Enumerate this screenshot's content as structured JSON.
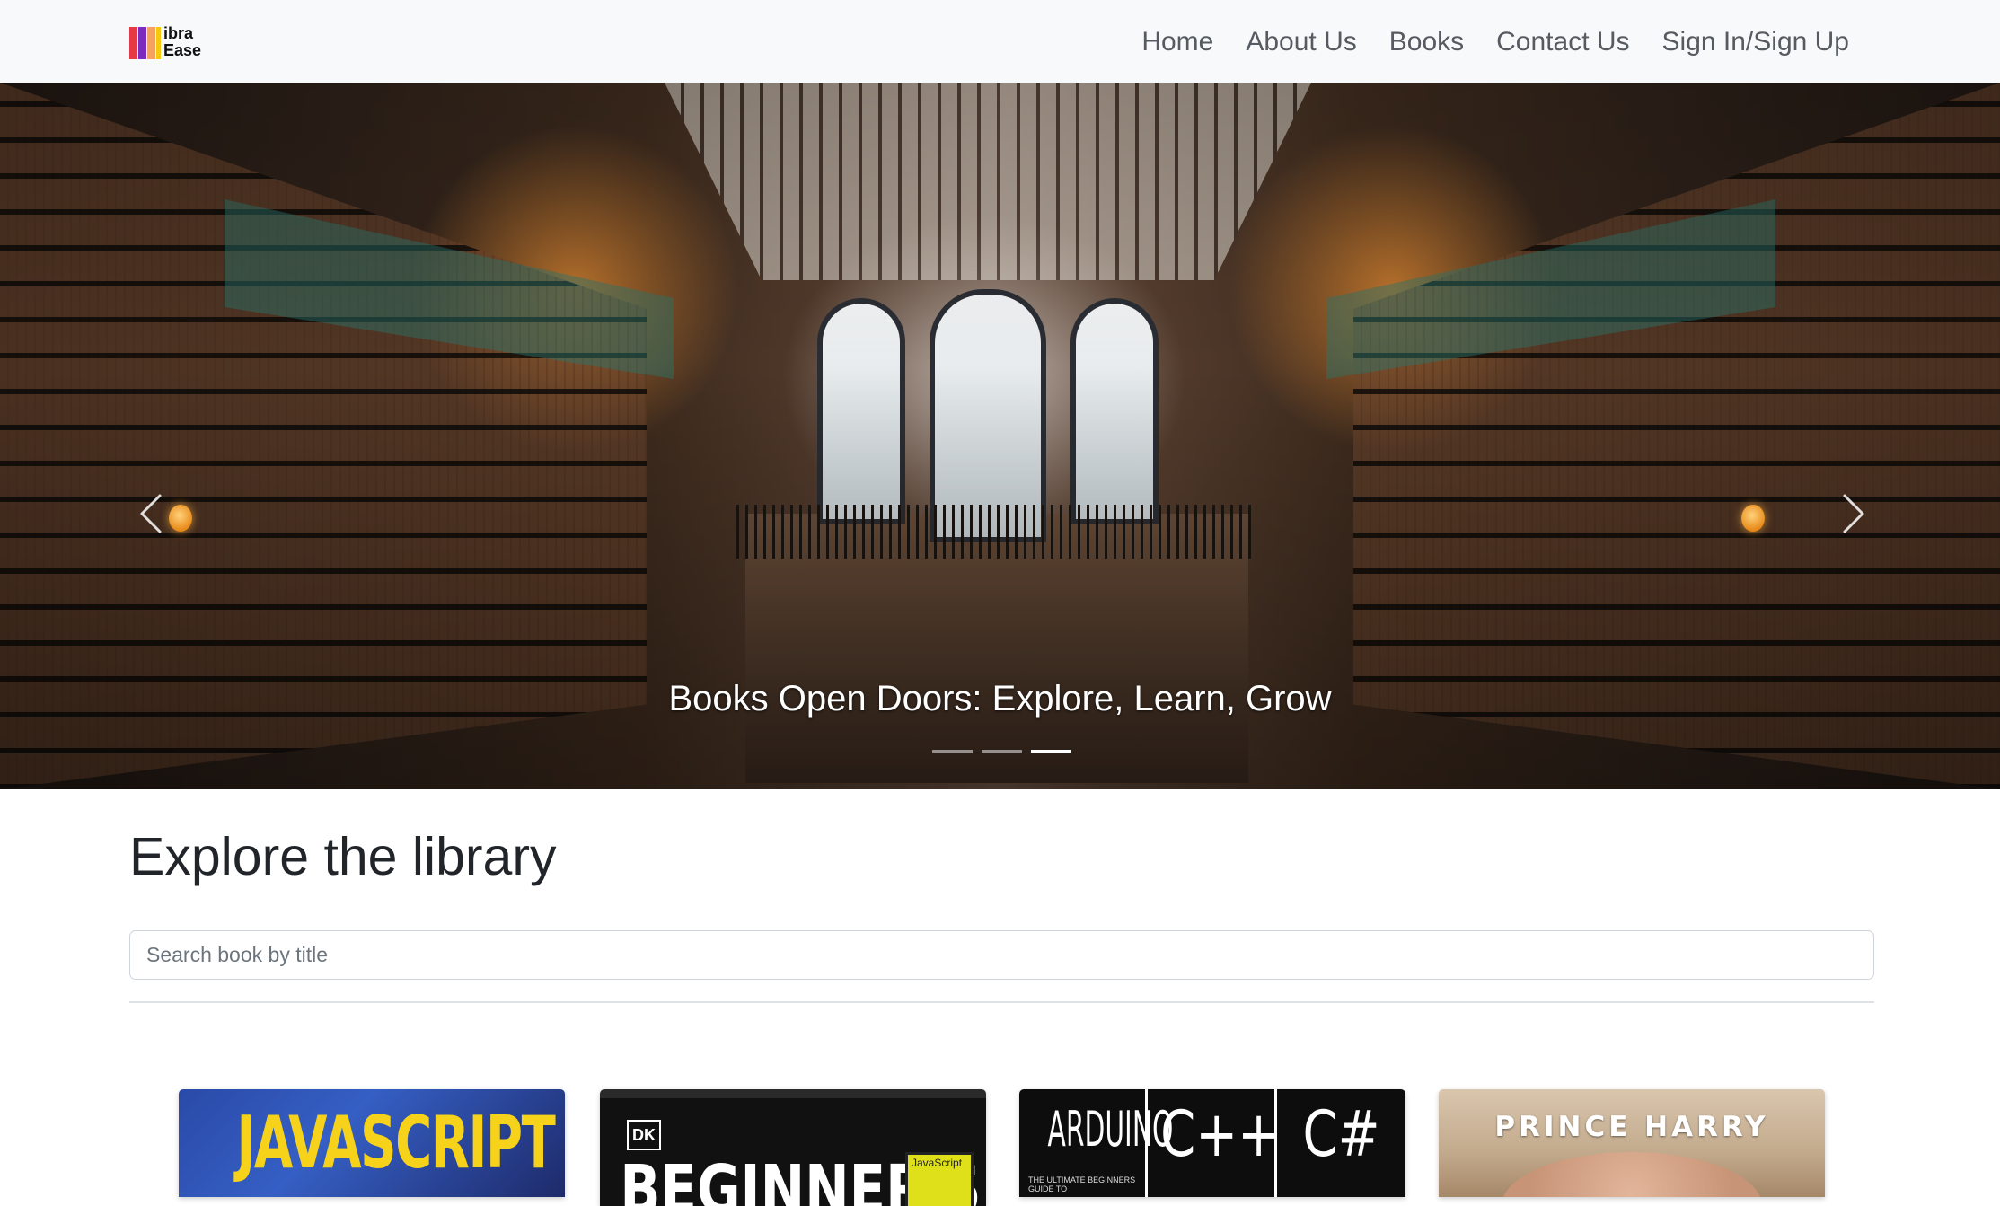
{
  "brand": {
    "line1": "ibra",
    "line2": "Ease"
  },
  "nav": {
    "items": [
      "Home",
      "About Us",
      "Books",
      "Contact Us",
      "Sign In/Sign Up"
    ]
  },
  "hero": {
    "caption": "Books Open Doors: Explore, Learn, Grow",
    "slide_count": 3,
    "active_slide": 3,
    "prev_icon": "chevron-left-icon",
    "next_icon": "chevron-right-icon"
  },
  "main": {
    "heading": "Explore the library",
    "search_placeholder": "Search book by title"
  },
  "books": [
    {
      "cover_text": "JAVASCRIPT",
      "accent": "#f7d21a"
    },
    {
      "cover_badge": "DK",
      "cover_text": "BEGINNER'S",
      "cover_tag": "JavaScript"
    },
    {
      "panels": [
        "ARDUINO",
        "C++",
        "C#"
      ],
      "cover_sub": "THE ULTIMATE BEGINNERS GUIDE TO"
    },
    {
      "cover_text": "PRINCE HARRY"
    }
  ],
  "colors": {
    "navbar_bg": "#f8f9fa",
    "nav_link": "#555b61",
    "text": "#212529",
    "border": "#ced4da"
  }
}
